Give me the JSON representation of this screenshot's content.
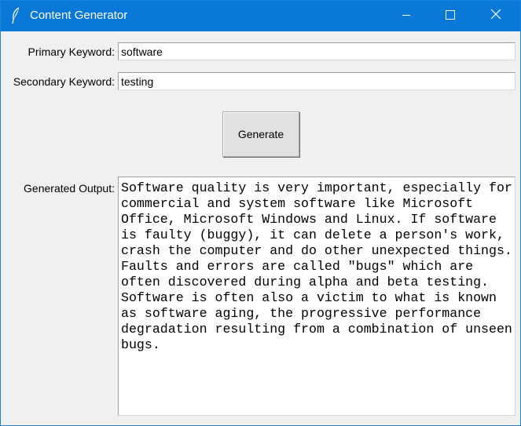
{
  "window": {
    "title": "Content Generator",
    "titlebar_color": "#0a78d7",
    "icon": "feather-icon",
    "controls": [
      "minimize-icon",
      "maximize-icon",
      "close-icon"
    ]
  },
  "form": {
    "primary_label": "Primary Keyword:",
    "primary_value": "software",
    "secondary_label": "Secondary Keyword:",
    "secondary_value": "testing",
    "generate_label": "Generate",
    "output_label": "Generated Output:",
    "output_text": "Software quality is very important, especially for\ncommercial and system software like Microsoft\nOffice, Microsoft Windows and Linux. If software\nis faulty (buggy), it can delete a person's work,\ncrash the computer and do other unexpected things.\nFaults and errors are called \"bugs\" which are\noften discovered during alpha and beta testing.\nSoftware is often also a victim to what is known\nas software aging, the progressive performance\ndegradation resulting from a combination of unseen\nbugs."
  }
}
